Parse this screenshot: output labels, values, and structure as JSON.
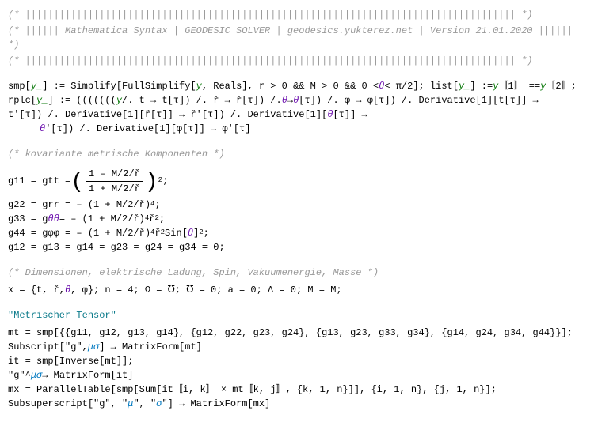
{
  "header": {
    "bar": "(* |||||||||||||||||||||||||||||||||||||||||||||||||||||||||||||||||||||||||||||||||||||| *)",
    "title": "(* |||||| Mathematica Syntax | GEODESIC SOLVER | geodesics.yukterez.net | Version 21.01.2020 |||||| *)"
  },
  "smp": {
    "def1": "smp[",
    "yarg": "y_",
    "def2": "] := Simplify[FullSimplify[",
    "y": "y",
    "def3": ", Reals], r > 0 && M > 0 && 0 < ",
    "theta": "θ",
    "def4": " < π/2]; list[",
    "def5": "] := ",
    "lb1": "〚1〛 == ",
    "lb2": "〚2〛;"
  },
  "rplc": {
    "a1": "rplc[",
    "a2": "] := (((((((",
    "a3": " /. t → t[τ]) /. ř → ř[τ]) /. ",
    "a4": " → ",
    "a5": "[τ]) /. φ → φ[τ]) /. Derivative[1][t[τ]] →",
    "b1": "t'[τ]) /. Derivative[1][ř[τ]] → ř'[τ]) /. Derivative[1][",
    "b2": "[τ]] →",
    "c1": "'[τ]) /. Derivative[1][φ[τ]] → φ'[τ]"
  },
  "metric_comment": "(* kovariante metrische Komponenten *)",
  "g11": {
    "a": "g11 = gtt = ",
    "num": "1 – M/2/ř",
    "den": "1 + M/2/ř",
    "exp": "2",
    "end": ";"
  },
  "g22": "g22 = grr = – (1 + M/2/ř)",
  "g22e": "4",
  "g22end": ";",
  "g33a": "g33 = g",
  "g33b": " = – (1 + M/2/ř)",
  "g33e": "4",
  "g33c": " ř",
  "g33f": "2",
  "g33end": ";",
  "g44a": "g44 = gφφ = – (1 + M/2/ř)",
  "g44e4": "4",
  "g44b": " ř",
  "g44e2a": "2",
  "g44c": " Sin[",
  "g44d": "]",
  "g44e2b": "2",
  "g44end": ";",
  "gzero": "g12 = g13 = g14 = g23 = g24 = g34 = 0;",
  "dim_comment": "(* Dimensionen, elektrische Ladung, Spin, Vakuumenergie, Masse *)",
  "xdef": {
    "a": "x = {t, ř, ",
    "b": ", φ}; n = 4; Ω = ℧; ℧ = 0; a = 0; Λ = 0; M = M;"
  },
  "mt_title": "\"Metrischer Tensor\"",
  "mt_line": "mt = smp[{{g11, g12, g13, g14}, {g12, g22, g23, g24}, {g13, g23, g33, g34}, {g14, g24, g34, g44}}];",
  "sub1a": "Subscript[\"g\", ",
  "sub_mu": "μσ",
  "sub1b": "] → MatrixForm[mt]",
  "it_line": "it = smp[Inverse[mt]];",
  "g_up_a": "\"g\"^",
  "g_up_b": " → MatrixForm[it]",
  "mx_line": "mx = ParallelTable[smp[Sum[it〚i, k〛 × mt〚k, j〛, {k, 1, n}]], {i, 1, n}, {j, 1, n}];",
  "subsup_a": "Subsuperscript[\"g\", \"",
  "subsup_mu": "μ",
  "subsup_b": "\", \"",
  "subsup_sig": "σ",
  "subsup_c": "\"] → MatrixForm[mx]"
}
